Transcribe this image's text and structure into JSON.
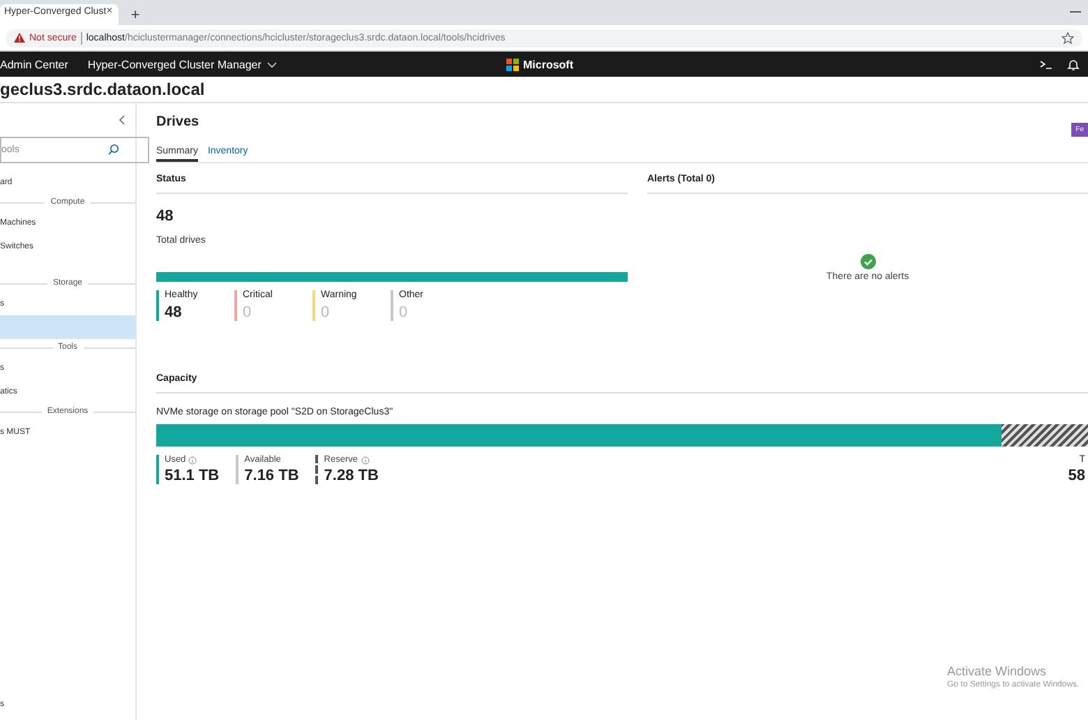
{
  "browser": {
    "tab_title": "Hyper-Converged Clust",
    "tab_close": "×",
    "new_tab": "+",
    "security": "Not secure",
    "url_host": "localhost",
    "url_path": "/hciclustermanager/connections/hcicluster/storageclus3.srdc.dataon.local/tools/hcidrives"
  },
  "app_bar": {
    "product": "Admin Center",
    "tool": "Hyper-Converged Cluster Manager",
    "brand": "Microsoft"
  },
  "connection_title": "geclus3.srdc.dataon.local",
  "sidebar": {
    "search": {
      "placeholder": "ools"
    },
    "items": [
      {
        "kind": "item",
        "label": "ard",
        "selected": false
      },
      {
        "kind": "header",
        "label": "Compute"
      },
      {
        "kind": "item",
        "label": "Machines",
        "selected": false
      },
      {
        "kind": "item",
        "label": "Switches",
        "selected": false
      },
      {
        "kind": "spacer"
      },
      {
        "kind": "header",
        "label": "Storage"
      },
      {
        "kind": "item",
        "label": "s",
        "selected": false
      },
      {
        "kind": "item",
        "selected": true
      },
      {
        "kind": "header",
        "label": "Tools"
      },
      {
        "kind": "item",
        "label": "s",
        "selected": false
      },
      {
        "kind": "item",
        "label": "atics",
        "selected": false
      },
      {
        "kind": "header",
        "label": "Extensions"
      },
      {
        "kind": "item",
        "label": "s MUST",
        "selected": false
      }
    ],
    "footer_item": "s"
  },
  "page": {
    "title": "Drives",
    "feedback_button": "Fe",
    "tabs": [
      {
        "label": "Summary",
        "selected": true
      },
      {
        "label": "Inventory",
        "selected": false
      }
    ],
    "status": {
      "title": "Status",
      "total": "48",
      "total_label": "Total drives",
      "bar": {
        "level": 1
      },
      "legend": [
        {
          "label": "Healthy",
          "value": "48",
          "color": "#13a89e",
          "dimmed": false
        },
        {
          "label": "Critical",
          "value": "0",
          "color": "#f2a7a7",
          "dimmed": true
        },
        {
          "label": "Warning",
          "value": "0",
          "color": "#f5d77a",
          "dimmed": true
        },
        {
          "label": "Other",
          "value": "0",
          "color": "#c8c8c8",
          "dimmed": true
        }
      ]
    },
    "alerts": {
      "title": "Alerts (Total 0)",
      "message": "There are no alerts"
    },
    "capacity": {
      "title": "Capacity",
      "description": "NVMe storage on storage pool \"S2D on StorageClus3\"",
      "bar": {
        "level": 0.905
      },
      "legend": [
        {
          "kind": "solid",
          "label": "Used",
          "info": true,
          "value": "51.1 TB",
          "color": "#13a89e"
        },
        {
          "kind": "solid",
          "label": "Available",
          "info": false,
          "value": "7.16 TB",
          "color": "#c8c8c8"
        },
        {
          "kind": "hatched",
          "label": "Reserve",
          "info": true,
          "value": "7.28 TB",
          "color": "#555555"
        }
      ],
      "total": {
        "label": "T",
        "value": "58"
      }
    }
  },
  "os_notice": {
    "title": "Activate Windows",
    "subtitle": "Go to Settings to activate Windows."
  }
}
